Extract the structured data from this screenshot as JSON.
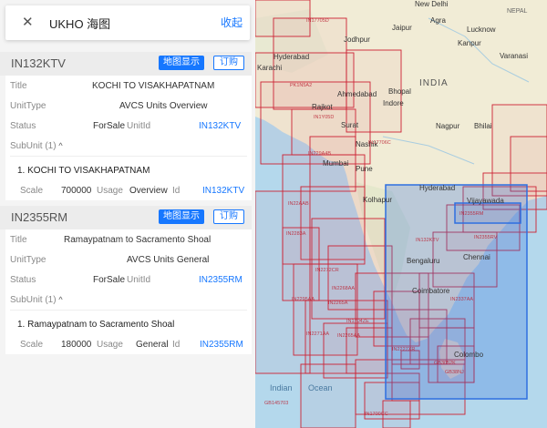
{
  "header": {
    "title": "UKHO 海图",
    "collapse_label": "收起",
    "close_icon": "close-icon"
  },
  "buttons": {
    "map_show": "地图显示",
    "subscribe": "订购"
  },
  "fields": {
    "title": "Title",
    "unit_type": "UnitType",
    "status": "Status",
    "unit_id": "UnitId",
    "scale": "Scale",
    "usage": "Usage",
    "id": "Id"
  },
  "cards": [
    {
      "id": "IN132KTV",
      "title": "KOCHI TO VISAKHAPATNAM",
      "unit_type": "AVCS Units Overview",
      "status": "ForSale",
      "unit_id": "IN132KTV",
      "subunit_label": "SubUnit (1)",
      "sub": {
        "name": "1. KOCHI TO VISAKHAPATNAM",
        "scale": "700000",
        "usage": "Overview",
        "id": "IN132KTV"
      }
    },
    {
      "id": "IN2355RM",
      "title": "Ramaypatnam to Sacramento Shoal",
      "unit_type": "AVCS Units General",
      "status": "ForSale",
      "unit_id": "IN2355RM",
      "subunit_label": "SubUnit (1)",
      "sub": {
        "name": "1. Ramaypatnam to Sacramento Shoal",
        "scale": "180000",
        "usage": "General",
        "id": "IN2355RM"
      }
    }
  ],
  "map": {
    "labels": [
      "New Delhi",
      "NEPAL",
      "Jaipur",
      "Agra",
      "Lucknow",
      "Kanpur",
      "Jodhpur",
      "Varanasi",
      "Karachi",
      "Hyderabad",
      "INDIA",
      "Ahmedabad",
      "Bhopal",
      "Indore",
      "Rajkot",
      "Surat",
      "Nagpur",
      "Bhilai",
      "Nashik",
      "Mumbai",
      "Pune",
      "Hyderabad",
      "Kolhapur",
      "Vijayawada",
      "Bengaluru",
      "Chennai",
      "Coimbatore",
      "Colombo",
      "Indian",
      "Ocean"
    ],
    "chart_codes": [
      "IN17705D",
      "PK1N5A2",
      "IN1Y05D",
      "IN17706C",
      "IN229A4B",
      "IN22AAB",
      "IN132KTV",
      "IN2355RM",
      "IN2355RV",
      "IN2272CR",
      "IN2268AA",
      "IN2265A",
      "IN2283A",
      "IN2295AA",
      "IN2271AA",
      "IN2265AA",
      "IN2337AA",
      "IN1704ZE",
      "IN2227XR",
      "GB3052K",
      "GB38NJ",
      "GB145703",
      "IN1700CC"
    ],
    "colors": {
      "land": "#f1ecd6",
      "sea": "#b4d8ec",
      "sea_deep": "#9cccf0",
      "chart_border": "#cc2233",
      "highlight_border": "#2e6fe0",
      "highlight_fill": "#2e6fe0"
    }
  }
}
